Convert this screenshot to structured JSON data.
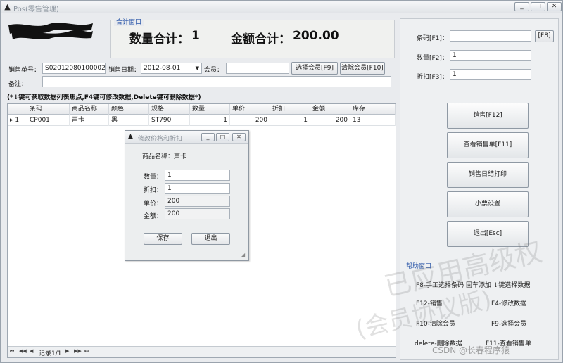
{
  "window": {
    "title": "Pos(零售管理)",
    "minimize": "_",
    "maximize": "□",
    "close": "✕"
  },
  "summary": {
    "group_title": "合计窗口",
    "qty_label": "数量合计：",
    "qty_value": "1",
    "amount_label": "金额合计：",
    "amount_value": "200.00"
  },
  "form": {
    "order_no_label": "销售单号：",
    "order_no_value": "S02012080100002",
    "date_label": "销售日期：",
    "date_value": "2012-08-01",
    "member_label": "会员：",
    "member_value": "",
    "select_member_button": "选择会员[F9]",
    "clear_member_button": "清除会员[F10]",
    "remark_label": "备注：",
    "remark_value": ""
  },
  "hint": "(*↓键可获取数据列表焦点,F4键可修改数据,Delete键可删除数据*)",
  "grid": {
    "columns": [
      "条码",
      "商品名称",
      "颜色",
      "规格",
      "数量",
      "单价",
      "折扣",
      "金额",
      "库存"
    ],
    "rows": [
      {
        "indicator": "▸ 1",
        "barcode": "CP001",
        "name": "声卡",
        "color": "黑",
        "spec": "ST790",
        "qty": "1",
        "price": "200",
        "discount": "1",
        "amount": "200",
        "stock": "13"
      }
    ],
    "nav": {
      "first": "⏮",
      "prev_page": "◀◀",
      "prev": "◀",
      "record": "记录1/1",
      "next": "▶",
      "next_page": "▶▶",
      "last": "⏭"
    }
  },
  "dialog": {
    "title": "修改价格和折扣",
    "product_label": "商品名称：声卡",
    "qty_label": "数量：",
    "qty_value": "1",
    "discount_label": "折扣：",
    "discount_value": "1",
    "price_label": "单价：",
    "price_value": "200",
    "amount_label": "金额：",
    "amount_value": "200",
    "save_button": "保存",
    "exit_button": "退出"
  },
  "right_panel": {
    "barcode_label": "条码[F1]：",
    "barcode_value": "",
    "f8_button": "[F8]",
    "qty_label": "数量[F2]：",
    "qty_value": "1",
    "discount_label": "折扣[F3]：",
    "discount_value": "1",
    "buttons": [
      "销售[F12]",
      "查看销售单[F11]",
      "销售日结打印",
      "小票设置",
      "退出[Esc]"
    ]
  },
  "help": {
    "title": "帮助窗口",
    "line1": "F8-手工选择条码 回车添加 ↓键选择数据",
    "f12": "F12-销售",
    "f4": "F4-修改数据",
    "f10": "F10-清除会员",
    "f9": "F9-选择会员",
    "delete": "delete-删除数据",
    "f11": "F11-查看销售单"
  },
  "watermark": {
    "line1": "已应用高级权",
    "line2": "(会员协议版)",
    "csdn": "CSDN @长春程序猿"
  },
  "icons": {
    "app_icon": "penguin-icon",
    "dropdown": "chevron-down-icon"
  }
}
